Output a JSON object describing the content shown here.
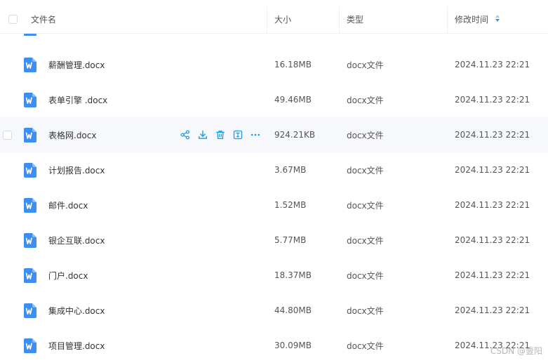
{
  "header": {
    "name": "文件名",
    "size": "大小",
    "type": "类型",
    "modified": "修改时间"
  },
  "accent_color": "#1e9be8",
  "file_icon_color": "#3d8ef0",
  "rows": [
    {
      "name": "薪酬管理.docx",
      "size": "16.18MB",
      "type": "docx文件",
      "modified": "2024.11.23 22:21"
    },
    {
      "name": "表单引擎 .docx",
      "size": "49.46MB",
      "type": "docx文件",
      "modified": "2024.11.23 22:21"
    },
    {
      "name": "表格网.docx",
      "size": "924.21KB",
      "type": "docx文件",
      "modified": "2024.11.23 22:21"
    },
    {
      "name": "计划报告.docx",
      "size": "3.67MB",
      "type": "docx文件",
      "modified": "2024.11.23 22:21"
    },
    {
      "name": "邮件.docx",
      "size": "1.52MB",
      "type": "docx文件",
      "modified": "2024.11.23 22:21"
    },
    {
      "name": "银企互联.docx",
      "size": "5.77MB",
      "type": "docx文件",
      "modified": "2024.11.23 22:21"
    },
    {
      "name": "门户.docx",
      "size": "18.37MB",
      "type": "docx文件",
      "modified": "2024.11.23 22:21"
    },
    {
      "name": "集成中心.docx",
      "size": "44.80MB",
      "type": "docx文件",
      "modified": "2024.11.23 22:21"
    },
    {
      "name": "项目管理.docx",
      "size": "30.09MB",
      "type": "docx文件",
      "modified": "2024.11.23 22:21"
    }
  ],
  "hovered_row_index": 2,
  "hover_actions": [
    "share-icon",
    "download-icon",
    "delete-icon",
    "rename-icon",
    "more-icon"
  ],
  "watermark": "CSDN @壹阳"
}
